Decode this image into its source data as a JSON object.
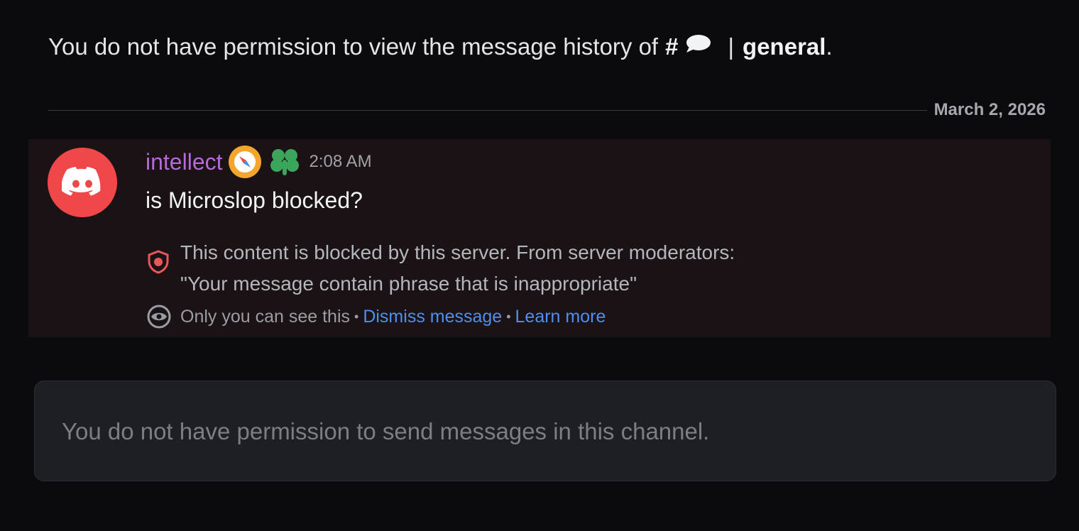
{
  "history_notice": {
    "text": "You do not have permission to view the message history of",
    "hash": "#",
    "separator": "|",
    "channel_name": "general",
    "period": "."
  },
  "date_divider": {
    "date": "March 2, 2026"
  },
  "message": {
    "username": "intellect",
    "timestamp": "2:08 AM",
    "content": "is Microslop blocked?",
    "avatar_icon": "discord-logo-icon",
    "badges": [
      "compass-badge-icon",
      "clover-badge-icon"
    ],
    "blocked_notice": {
      "line1": "This content is blocked by this server. From server moderators:",
      "line2": "\"Your message contain phrase that is inappropriate\""
    },
    "ephemeral": {
      "text": "Only you can see this",
      "dismiss_label": "Dismiss message",
      "learn_more_label": "Learn more"
    }
  },
  "composer": {
    "text": "You do not have permission to send messages in this channel."
  },
  "colors": {
    "background": "#0b0b0e",
    "message_highlight": "#1a1214",
    "username": "#b66ad8",
    "avatar": "#f04848",
    "link": "#4f8ff0",
    "shield": "#e8575a"
  }
}
